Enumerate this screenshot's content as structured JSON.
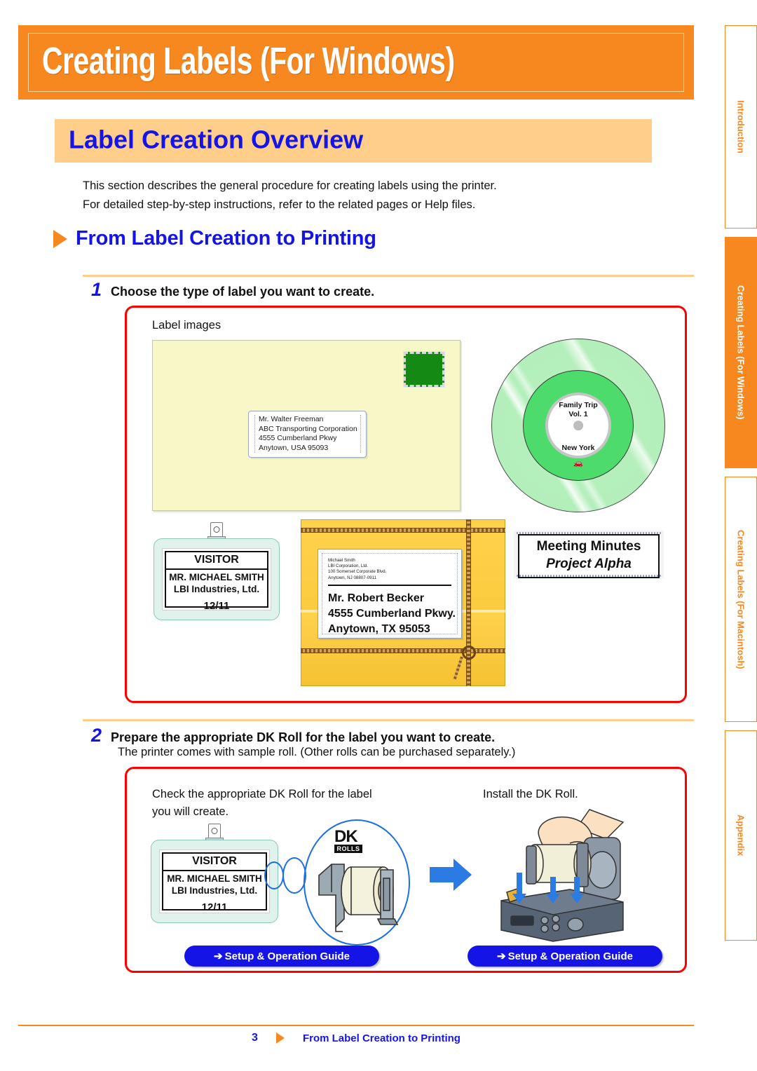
{
  "banner": {
    "title": "Creating Labels (For Windows)"
  },
  "section": {
    "title": "Label Creation Overview"
  },
  "intro": {
    "line1": "This section describes the general procedure for creating labels using the printer.",
    "line2": "For detailed step-by-step instructions, refer to the related pages or Help files."
  },
  "subhead": {
    "title": "From Label Creation to Printing"
  },
  "step1": {
    "number": "1",
    "text": "Choose the type of label you want to create.",
    "caption": "Label images",
    "envelope_label": {
      "line1": "Mr. Walter Freeman",
      "line2": "ABC Transporting Corporation",
      "line3": "4555 Cumberland Pkwy",
      "line4": "Anytown, USA 95093"
    },
    "cd_label": {
      "title": "Family Trip",
      "volume": "Vol. 1",
      "place": "New York",
      "icon": "car-icon"
    },
    "badge": {
      "title": "VISITOR",
      "name": "MR. MICHAEL SMITH",
      "company": "LBI Industries, Ltd.",
      "date": "12/11"
    },
    "shipping_label": {
      "from_line1": "Michael Smith",
      "from_line2": "LBI Corporation, Ltd.",
      "from_line3": "100 Somerset Corporate Blvd.",
      "from_line4": "Anytown, NJ  08807-0911",
      "to_line1": "Mr. Robert Becker",
      "to_line2": "4555 Cumberland Pkwy.",
      "to_line3": "Anytown, TX  95053"
    },
    "minutes_label": {
      "line1": "Meeting Minutes",
      "line2": "Project Alpha"
    }
  },
  "step2": {
    "number": "2",
    "text": "Prepare the appropriate DK Roll  for the label you want to create.",
    "subtext": "The printer comes with sample roll. (Other rolls can be purchased separately.)",
    "left_caption_line1": "Check the appropriate DK Roll  for the label",
    "left_caption_line2": "you will create.",
    "right_caption": "Install the DK Roll.",
    "dk_logo": {
      "mark": "DK",
      "sub": "ROLLS"
    },
    "badge": {
      "title": "VISITOR",
      "name": "MR. MICHAEL SMITH",
      "company": "LBI Industries, Ltd.",
      "date": "12/11"
    },
    "link_left": "Setup & Operation Guide",
    "link_right": "Setup & Operation Guide",
    "link_arrow": "➔"
  },
  "tabs": [
    {
      "label": "Introduction",
      "active": false
    },
    {
      "label": "Creating Labels (For Windows)",
      "active": true
    },
    {
      "label": "Creating Labels (For Macintosh)",
      "active": false
    },
    {
      "label": "Appendix",
      "active": false
    }
  ],
  "footer": {
    "page": "3",
    "text": "From Label Creation to Printing"
  },
  "colors": {
    "orange": "#F7871F",
    "light_orange": "#FFCE8A",
    "blue": "#1414E6",
    "red": "#FF0000",
    "envelope": "#F7F7C8",
    "stamp_green": "#148A14",
    "package_yellow": "#FFD24D",
    "badge_green": "#DFF2EC"
  }
}
